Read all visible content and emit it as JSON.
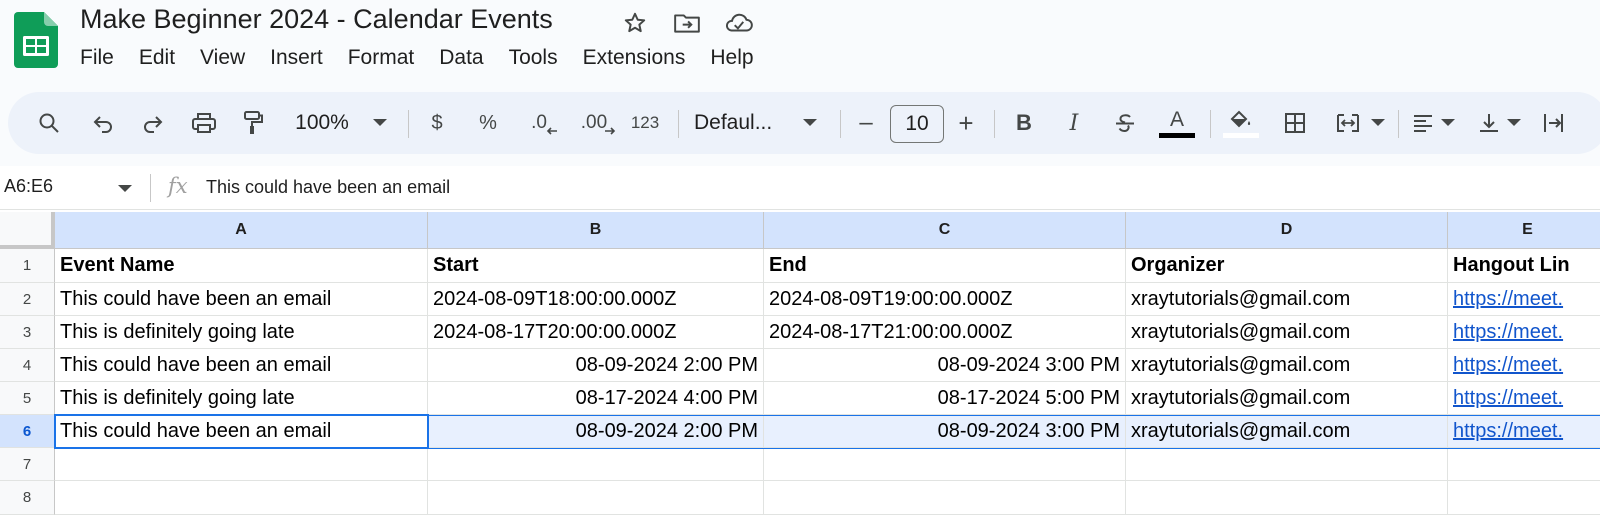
{
  "app": {
    "title": "Make Beginner 2024 - Calendar Events",
    "menu": [
      "File",
      "Edit",
      "View",
      "Insert",
      "Format",
      "Data",
      "Tools",
      "Extensions",
      "Help"
    ],
    "brand_color": "#0f9d58"
  },
  "toolbar": {
    "zoom": "100%",
    "currency": "$",
    "percent": "%",
    "decrease_decimal": ".0",
    "increase_decimal": ".00",
    "number_format": "123",
    "font": "Defaul...",
    "font_size": "10",
    "minus": "–",
    "plus": "+",
    "bold": "B",
    "italic": "I",
    "text_color_letter": "A"
  },
  "formula_bar": {
    "name_box": "A6:E6",
    "fx": "fx",
    "content": "This could have been an email"
  },
  "grid": {
    "columns": [
      "A",
      "B",
      "C",
      "D",
      "E"
    ],
    "row_numbers": [
      "1",
      "2",
      "3",
      "4",
      "5",
      "6",
      "7",
      "8"
    ],
    "header": [
      "Event Name",
      "Start",
      "End",
      "Organizer",
      "Hangout Lin"
    ],
    "rows": [
      [
        "This could have been an email",
        "2024-08-09T18:00:00.000Z",
        "2024-08-09T19:00:00.000Z",
        "xraytutorials@gmail.com",
        "https://meet."
      ],
      [
        "This is definitely going late",
        "2024-08-17T20:00:00.000Z",
        "2024-08-17T21:00:00.000Z",
        "xraytutorials@gmail.com",
        "https://meet."
      ],
      [
        "This could have been an email",
        "08-09-2024 2:00 PM",
        "08-09-2024 3:00 PM",
        "xraytutorials@gmail.com",
        "https://meet."
      ],
      [
        "This is definitely going late",
        "08-17-2024 4:00 PM",
        "08-17-2024 5:00 PM",
        "xraytutorials@gmail.com",
        "https://meet."
      ],
      [
        "This could have been an email",
        "08-09-2024 2:00 PM",
        "08-09-2024 3:00 PM",
        "xraytutorials@gmail.com",
        "https://meet."
      ]
    ],
    "selected_range": "A6:E6",
    "selection_color": "#1a73e8"
  }
}
